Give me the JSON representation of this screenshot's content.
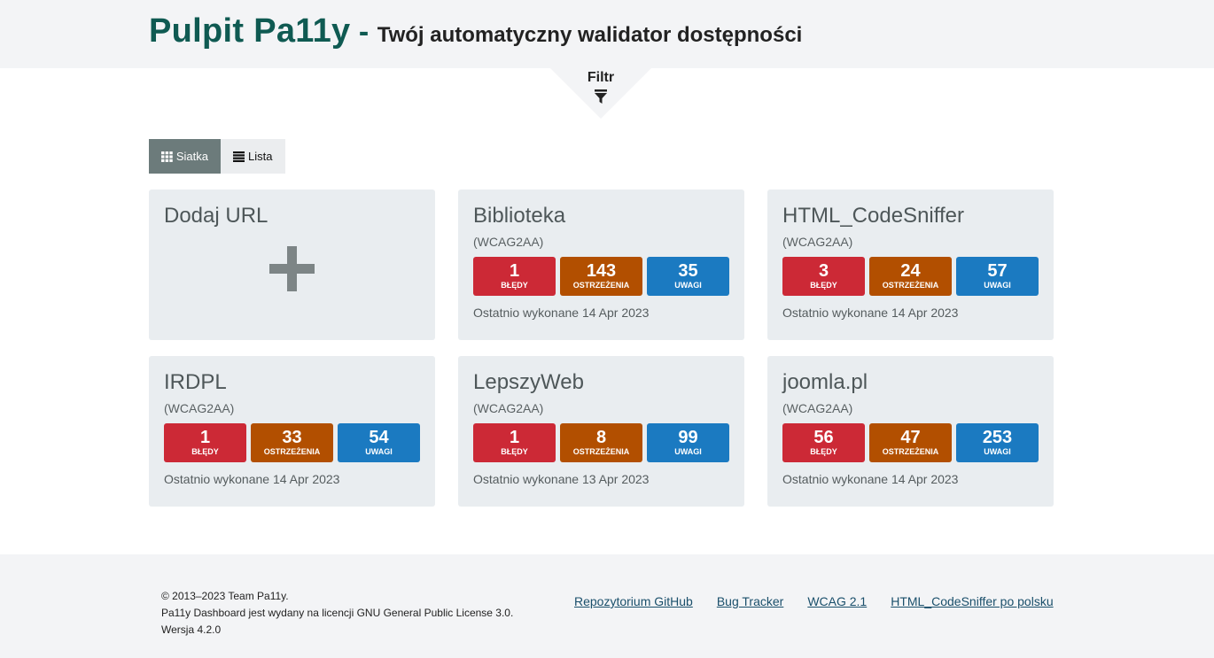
{
  "header": {
    "brand": "Pulpit Pa11y",
    "separator": " - ",
    "tagline": "Twój automatyczny walidator dostępności"
  },
  "filter": {
    "label": "Filtr",
    "icon": "filter-icon"
  },
  "view_toggle": {
    "grid_label": "Siatka",
    "grid_icon": "grid-icon",
    "list_label": "Lista",
    "list_icon": "list-icon",
    "active": "grid"
  },
  "add_card": {
    "label": "Dodaj URL",
    "icon": "plus-icon"
  },
  "tasks": [
    {
      "name": "Biblioteka",
      "standard": "(WCAG2AA)",
      "errors": "1",
      "errors_label": "BŁĘDY",
      "warnings": "143",
      "warnings_label": "OSTRZEŻENIA",
      "notices": "35",
      "notices_label": "UWAGI",
      "last_run": "Ostatnio wykonane 14 Apr 2023"
    },
    {
      "name": "HTML_CodeSniffer",
      "standard": "(WCAG2AA)",
      "errors": "3",
      "errors_label": "BŁĘDY",
      "warnings": "24",
      "warnings_label": "OSTRZEŻENIA",
      "notices": "57",
      "notices_label": "UWAGI",
      "last_run": "Ostatnio wykonane 14 Apr 2023"
    },
    {
      "name": "IRDPL",
      "standard": "(WCAG2AA)",
      "errors": "1",
      "errors_label": "BŁĘDY",
      "warnings": "33",
      "warnings_label": "OSTRZEŻENIA",
      "notices": "54",
      "notices_label": "UWAGI",
      "last_run": "Ostatnio wykonane 14 Apr 2023"
    },
    {
      "name": "LepszyWeb",
      "standard": "(WCAG2AA)",
      "errors": "1",
      "errors_label": "BŁĘDY",
      "warnings": "8",
      "warnings_label": "OSTRZEŻENIA",
      "notices": "99",
      "notices_label": "UWAGI",
      "last_run": "Ostatnio wykonane 13 Apr 2023"
    },
    {
      "name": "joomla.pl",
      "standard": "(WCAG2AA)",
      "errors": "56",
      "errors_label": "BŁĘDY",
      "warnings": "47",
      "warnings_label": "OSTRZEŻENIA",
      "notices": "253",
      "notices_label": "UWAGI",
      "last_run": "Ostatnio wykonane 14 Apr 2023"
    }
  ],
  "colors": {
    "errors": "#cc2936",
    "warnings": "#b24f00",
    "notices": "#1b7ac1",
    "brand": "#0f5a52"
  },
  "footer": {
    "copyright": "© 2013–2023 Team Pa11y.",
    "license": "Pa11y Dashboard jest wydany na licencji GNU General Public License 3.0.",
    "version": "Wersja 4.2.0",
    "links": [
      "Repozytorium GitHub",
      "Bug Tracker",
      "WCAG 2.1",
      "HTML_CodeSniffer po polsku"
    ]
  }
}
